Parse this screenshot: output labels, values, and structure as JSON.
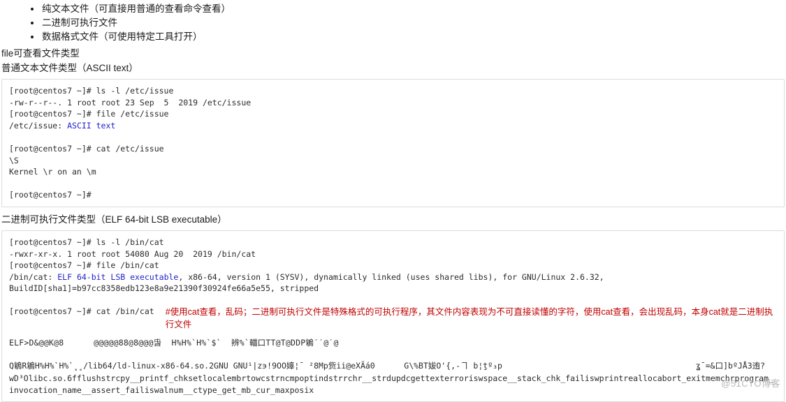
{
  "bullets": [
    "纯文本文件（可直接用普通的查看命令查看）",
    "二进制可执行文件",
    "数据格式文件（可使用特定工具打开）"
  ],
  "intro_line": "file可查看文件类型",
  "section1": {
    "heading": "普通文本文件类型（ASCII text）",
    "lines": {
      "l1": "[root@centos7 ~]# ls -l /etc/issue",
      "l2": "-rw-r--r--. 1 root root 23 Sep  5  2019 /etc/issue",
      "l3": "[root@centos7 ~]# file /etc/issue",
      "l4_prefix": "/etc/issue: ",
      "l4_keyword": "ASCII text",
      "l5": "[root@centos7 ~]# cat /etc/issue",
      "l6": "\\S",
      "l7": "Kernel \\r on an \\m",
      "l8": "[root@centos7 ~]#"
    }
  },
  "section2": {
    "heading": "二进制可执行文件类型（ELF 64-bit LSB executable）",
    "lines": {
      "l1": "[root@centos7 ~]# ls -l /bin/cat",
      "l2": "-rwxr-xr-x. 1 root root 54080 Aug 20  2019 /bin/cat",
      "l3": "[root@centos7 ~]# file /bin/cat",
      "l4_prefix": "/bin/cat: ",
      "l4_keyword": "ELF 64-bit LSB executable",
      "l4_suffix": ", x86-64, version 1 (SYSV), dynamically linked (uses shared libs), for GNU/Linux 2.6.32,",
      "l5": "BuildID[sha1]=b97cc8358edb123e8a9e21390f30924fe66a5e55, stripped",
      "l6_cmd": "[root@centos7 ~]# cat /bin/cat"
    },
    "annotation": {
      "part1": "#使用",
      "mono1": "cat",
      "part2": "查看，乱码；二进制可执行文件是特殊格式的可执行程序，其文件内容表现为不可直接读懂的字符，使用",
      "mono2": "cat",
      "part3": "查看，会出现乱码，本身",
      "mono3": "cat",
      "part4": "就是二进制执行文件"
    },
    "garbage": {
      "line1": "ELF>D&@@K@8      @@@@@88@8@@@旾  H%H%`H%`$`  辨%`輺口TT@T@DDP鵴ˊˊ@ˊ@",
      "line2": "Q鵴R鵴H%H%`H%`˳˳/lib64/ld-linux-x86-64.so.2GNU GNU¹|z϶!9OO嫴¦ˉ ²8Mp赀ii@eXÄá0      G\\%BT妭O'{,-ヿ b¦ṯº₃p                                        ʓˉ=&口]bºJÅ3迶?",
      "line3": "wD³Olibc.so.6fflushstrcpy__printf_chksetlocalembrtowcstrncmpoptindstrrchr__strdupdcgettexterroriswspace__stack_chk_failiswprintreallocabort_exitmemchrprogram_invocation_name__assert_failiswalnum__ctype_get_mb_cur_maxposix"
    }
  },
  "watermark": "@51CTO博客"
}
